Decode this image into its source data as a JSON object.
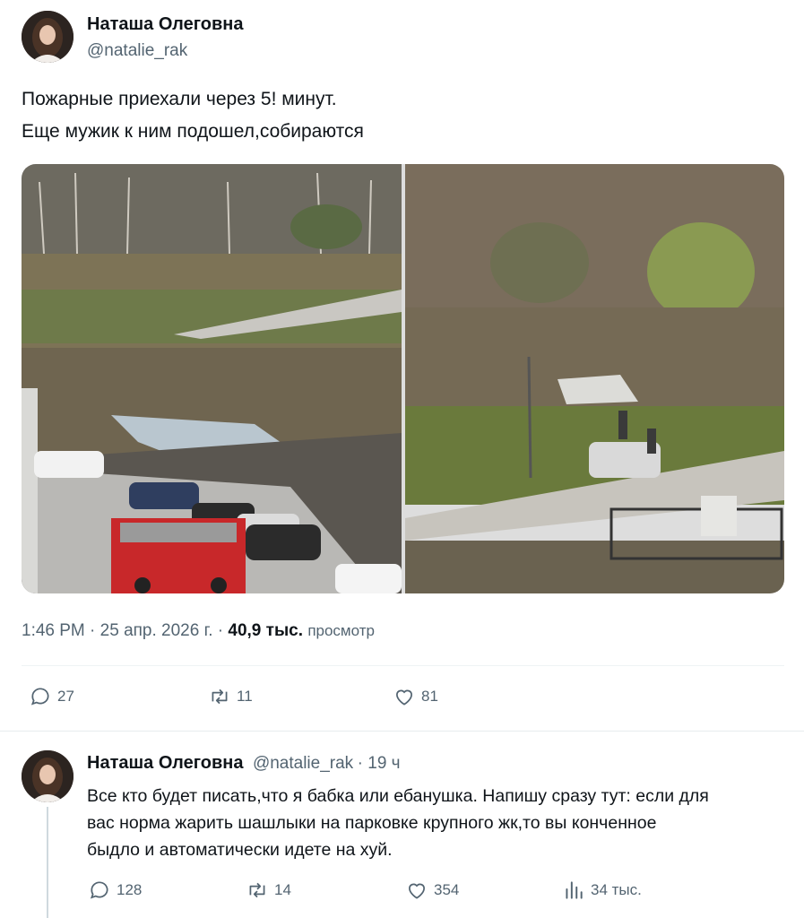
{
  "tweet": {
    "author_name": "Наташа Олеговна",
    "author_handle": "@natalie_rak",
    "text_line1": "Пожарные приехали через 5! минут.",
    "text_line2": "Еще мужик к ним подошел,собираются",
    "time": "1:46 PM",
    "date": "25 апр. 2026 г.",
    "views_count": "40,9 тыс.",
    "views_label": "просмотр",
    "replies": "27",
    "retweets": "11",
    "likes": "81"
  },
  "reply": {
    "author_name": "Наташа Олеговна",
    "author_handle": "@natalie_rak",
    "age": "19 ч",
    "text_line1": "Все кто будет писать,что я бабка или ебанушка. Напишу сразу тут: если для",
    "text_line2": "вас норма жарить шашлыки на парковке крупного жк,то вы конченное",
    "text_line3": "быдло и автоматически идете на хуй.",
    "replies": "128",
    "retweets": "14",
    "likes": "354",
    "views": "34 тыс."
  },
  "icons": {
    "reply": "speech-bubble-icon",
    "retweet": "retweet-icon",
    "like": "heart-icon",
    "views": "bar-chart-icon"
  },
  "colors": {
    "text": "#0f1419",
    "secondary": "#536471",
    "divider": "#eff3f4"
  }
}
